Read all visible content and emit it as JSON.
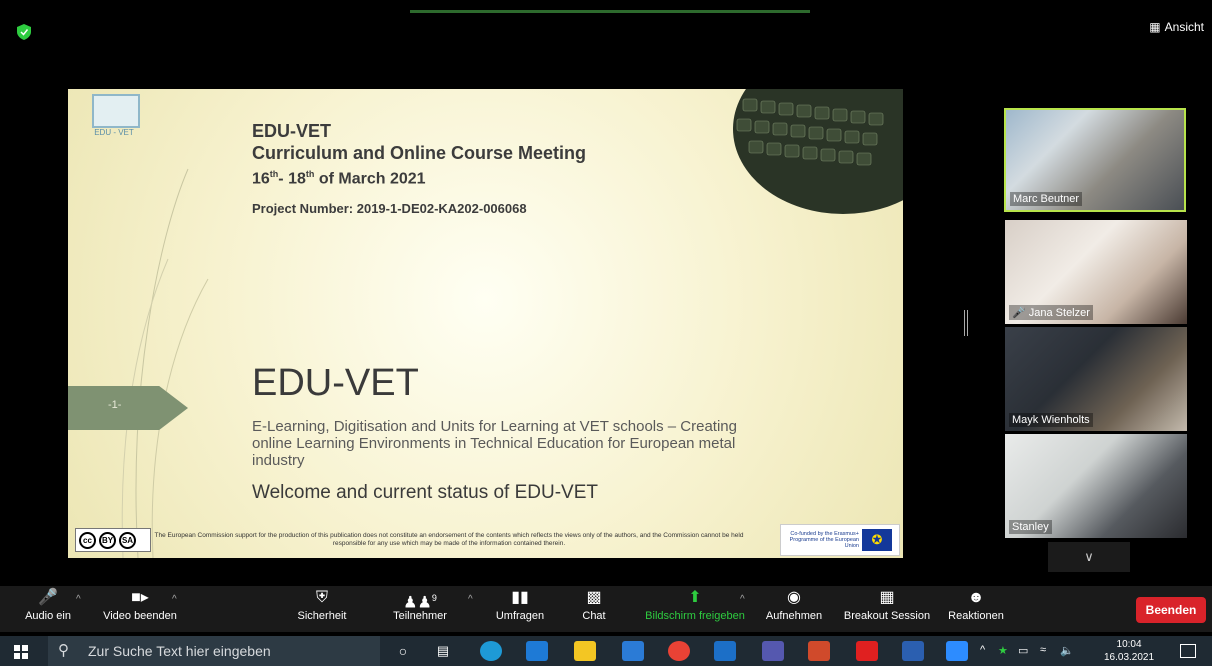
{
  "top": {
    "view_label": "Ansicht"
  },
  "slide": {
    "logo_text": "EDU - VET",
    "title_line1": "EDU-VET",
    "title_line2": "Curriculum and Online Course Meeting",
    "title_dates_a": "16",
    "title_dates_a_sup": "th",
    "title_dates_b": "- 18",
    "title_dates_b_sup": "th",
    "title_dates_c": " of March 2021",
    "project_number": "Project Number: 2019-1-DE02-KA202-006068",
    "page_label": "-1-",
    "big_title": "EDU-VET",
    "subtitle": "E-Learning, Digitisation and Units for Learning at VET schools – Creating online Learning Environments in Technical Education for European metal industry",
    "welcome": "Welcome and current status of EDU-VET",
    "disclaimer": "The European Commission support for the production of this publication does not constitute an endorsement of the contents which reflects the views only of the authors, and the Commission cannot be held responsible for any use which may be made of the information contained therein.",
    "eu_text": "Co-funded by the Erasmus+ Programme of the European Union",
    "cc_labels": [
      "cc",
      "BY",
      "SA"
    ]
  },
  "participants": [
    {
      "name": "Marc Beutner"
    },
    {
      "name": "Jana Stelzer"
    },
    {
      "name": "Mayk Wienholts"
    },
    {
      "name": "Stanley"
    }
  ],
  "toolbar": {
    "audio": "Audio ein",
    "video": "Video beenden",
    "security": "Sicherheit",
    "participants": "Teilnehmer",
    "participants_count": "9",
    "polls": "Umfragen",
    "chat": "Chat",
    "share": "Bildschirm freigeben",
    "record": "Aufnehmen",
    "breakout": "Breakout Session",
    "reactions": "Reaktionen",
    "end": "Beenden"
  },
  "taskbar": {
    "search_placeholder": "Zur Suche Text hier eingeben",
    "time": "10:04",
    "date": "16.03.2021"
  }
}
